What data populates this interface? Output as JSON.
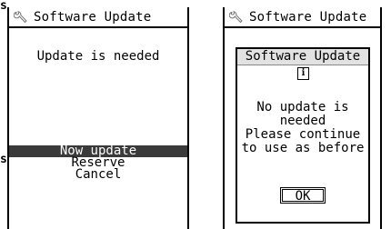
{
  "edge_glyph": "s",
  "left_screen": {
    "title": "Software Update",
    "message": "Update is needed",
    "menu": [
      {
        "label": "Now update",
        "selected": true
      },
      {
        "label": "Reserve",
        "selected": false
      },
      {
        "label": "Cancel",
        "selected": false
      }
    ]
  },
  "right_screen": {
    "title": "Software Update",
    "dialog": {
      "title": "Software Update",
      "icon": "i",
      "message": "No update is\nneeded\nPlease continue\nto use as before",
      "ok_label": "OK"
    }
  },
  "icons": {
    "title_icon": "wrench-icon",
    "dialog_icon": "info-icon"
  }
}
